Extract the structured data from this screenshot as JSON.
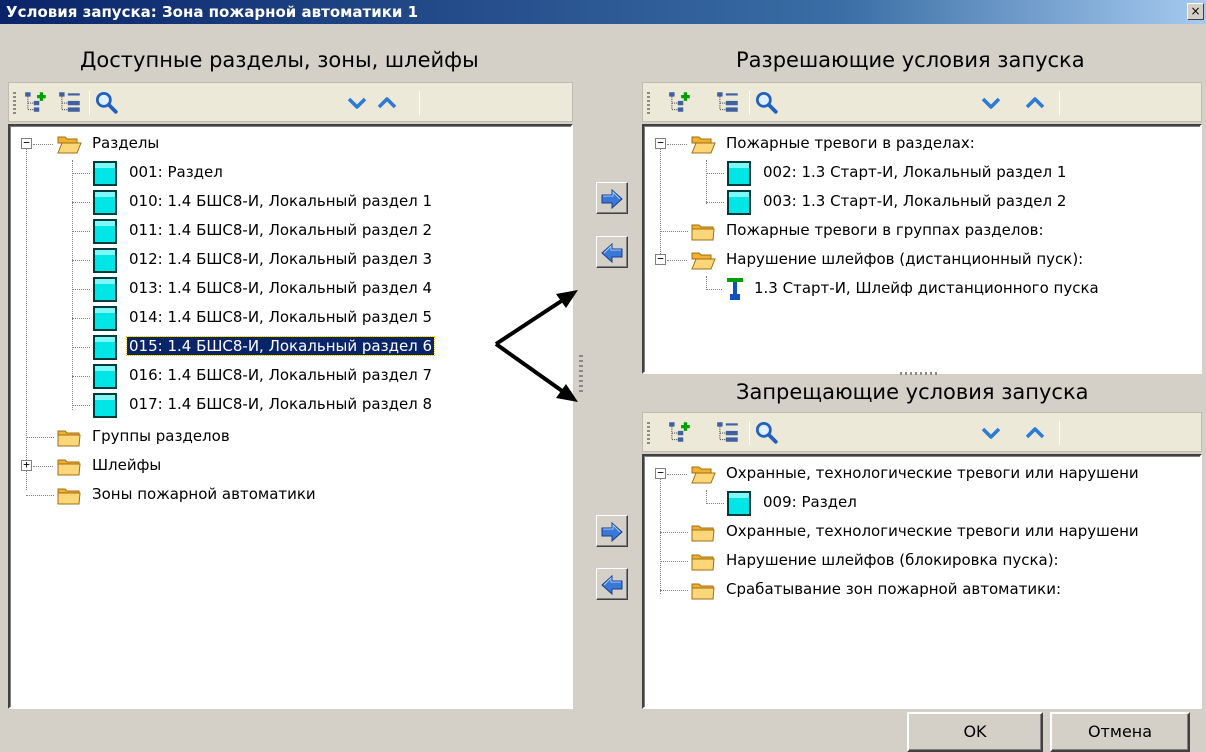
{
  "window": {
    "title": "Условия запуска: Зона пожарной автоматики 1",
    "close_glyph": "×"
  },
  "available": {
    "heading": "Доступные разделы, зоны, шлейфы",
    "search_placeholder": "",
    "tree": {
      "razdely": {
        "label": "Разделы",
        "children": [
          "001: Раздел",
          "010: 1.4 БШС8-И, Локальный раздел 1",
          "011: 1.4 БШС8-И, Локальный раздел 2",
          "012: 1.4 БШС8-И, Локальный раздел 3",
          "013: 1.4 БШС8-И, Локальный раздел 4",
          "014: 1.4 БШС8-И, Локальный раздел 5",
          "015: 1.4 БШС8-И, Локальный раздел 6",
          "016: 1.4 БШС8-И, Локальный раздел 7",
          "017: 1.4 БШС8-И, Локальный раздел 8"
        ]
      },
      "groups": "Группы разделов",
      "shleify": "Шлейфы",
      "zones": "Зоны пожарной автоматики"
    }
  },
  "permit": {
    "heading": "Разрешающие условия запуска",
    "search_placeholder": "",
    "tree": {
      "fire_alarms": {
        "label": "Пожарные тревоги в разделах:",
        "children": [
          "002: 1.3 Старт-И, Локальный раздел 1",
          "003: 1.3 Старт-И, Локальный раздел 2"
        ]
      },
      "fire_groups": "Пожарные тревоги в группах разделов:",
      "loop_remote": {
        "label": "Нарушение шлейфов (дистанционный пуск):",
        "children": [
          "1.3 Старт-И, Шлейф дистанционного пуска"
        ]
      }
    }
  },
  "forbid": {
    "heading": "Запрещающие условия запуска",
    "search_placeholder": "",
    "tree": {
      "security1": {
        "label": "Охранные, технологические тревоги или нарушени",
        "children": [
          "009: Раздел"
        ]
      },
      "security2": "Охранные, технологические тревоги или нарушени",
      "loop_block": "Нарушение шлейфов (блокировка пуска):",
      "zones_trigger": "Срабатывание зон пожарной автоматики:"
    }
  },
  "expanders": {
    "expanded": "−",
    "collapsed": "+"
  },
  "buttons": {
    "ok": "OK",
    "cancel": "Отмена"
  },
  "colors": {
    "title_bar": "#0a246a",
    "section_icon": "#00e5e5",
    "folder": "#f5c542",
    "selection": "#0a246a",
    "arrow_button": "#3a78d8"
  }
}
